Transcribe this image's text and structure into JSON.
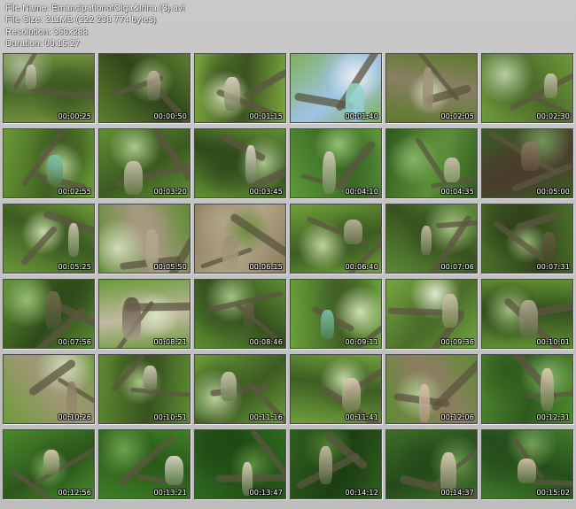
{
  "info": {
    "file_name": "File Name: EmancipationofOlga&Irina (3).avi",
    "file_size": "File Size: 211MB (222 238 774 bytes)",
    "resolution": "Resolution: 360x288",
    "duration": "Duration: 00:15:27"
  },
  "thumbnails": [
    {
      "time": "00:00:25",
      "palette": [
        "#6f8f3a",
        "#3f5a22",
        "#a7b892"
      ],
      "figure": "#d9cfc2"
    },
    {
      "time": "00:00:50",
      "palette": [
        "#5d7f2f",
        "#2f4519",
        "#9cb47a"
      ],
      "figure": "#c8b6a5"
    },
    {
      "time": "00:01:15",
      "palette": [
        "#7aa43e",
        "#3b5320",
        "#d6e2b8"
      ],
      "figure": "#e4d8c9"
    },
    {
      "time": "00:01:40",
      "palette": [
        "#7fb058",
        "#9fc4e8",
        "#e9edf0"
      ],
      "figure": "#8fd6c2"
    },
    {
      "time": "00:02:05",
      "palette": [
        "#5d7b2e",
        "#8a7f62",
        "#cfd7b9"
      ],
      "figure": "#a89a80"
    },
    {
      "time": "00:02:30",
      "palette": [
        "#6e9b3a",
        "#4c6b2a",
        "#b7cda0"
      ],
      "figure": "#d5c9bb"
    },
    {
      "time": "00:02:55",
      "palette": [
        "#6b9a35",
        "#3e5e22",
        "#b9d39a"
      ],
      "figure": "#7fc8b4"
    },
    {
      "time": "00:03:20",
      "palette": [
        "#5f8e33",
        "#3b5a20",
        "#aac98a"
      ],
      "figure": "#d8c9b7"
    },
    {
      "time": "00:03:45",
      "palette": [
        "#638f35",
        "#2f4a1b",
        "#a9c48b"
      ],
      "figure": "#e8e0d4"
    },
    {
      "time": "00:04:10",
      "palette": [
        "#5f9a3a",
        "#3a6a25",
        "#94c070"
      ],
      "figure": "#e0d2c4"
    },
    {
      "time": "00:04:35",
      "palette": [
        "#2f5a1f",
        "#5c8f3a",
        "#86b466"
      ],
      "figure": "#d8c4bb"
    },
    {
      "time": "00:05:00",
      "palette": [
        "#3a5e25",
        "#4a3c2c",
        "#72955a"
      ],
      "figure": "#8d7a60"
    },
    {
      "time": "00:05:25",
      "palette": [
        "#6a9838",
        "#3c5b22",
        "#c9dba8"
      ],
      "figure": "#d8cfc0"
    },
    {
      "time": "00:05:50",
      "palette": [
        "#5e8b32",
        "#a89a82",
        "#cfdcb9"
      ],
      "figure": "#b7aa95"
    },
    {
      "time": "00:06:15",
      "palette": [
        "#8a7c5e",
        "#b0a585",
        "#6a8a3a"
      ],
      "figure": "#9a8f72"
    },
    {
      "time": "00:06:40",
      "palette": [
        "#6fa23c",
        "#3d5c22",
        "#c0d49c"
      ],
      "figure": "#c9b8a8"
    },
    {
      "time": "00:07:06",
      "palette": [
        "#5c8b34",
        "#37521f",
        "#a7c283"
      ],
      "figure": "#d3c4b2"
    },
    {
      "time": "00:07:31",
      "palette": [
        "#4c6f2a",
        "#2f4319",
        "#9cb579"
      ],
      "figure": "#6a5a45"
    },
    {
      "time": "00:07:56",
      "palette": [
        "#5a8d30",
        "#2e4a1a",
        "#98bd72"
      ],
      "figure": "#7a6a52"
    },
    {
      "time": "00:08:21",
      "palette": [
        "#6a9a3a",
        "#c2b9a2",
        "#d8e3c2"
      ],
      "figure": "#5a4d3d"
    },
    {
      "time": "00:08:46",
      "palette": [
        "#5c8e32",
        "#354f1e",
        "#a4c382"
      ],
      "figure": "#6d5f4c"
    },
    {
      "time": "00:09:11",
      "palette": [
        "#6aa23a",
        "#405f24",
        "#cfe0b0"
      ],
      "figure": "#7fcbb5"
    },
    {
      "time": "00:09:36",
      "palette": [
        "#74a53e",
        "#4a6d2a",
        "#e1e8cf"
      ],
      "figure": "#d8c7b0"
    },
    {
      "time": "00:10:01",
      "palette": [
        "#5f8f32",
        "#344e1d",
        "#a2c07e"
      ],
      "figure": "#b9ad98"
    },
    {
      "time": "00:10:26",
      "palette": [
        "#6c9c3a",
        "#a29777",
        "#d0dcbc"
      ],
      "figure": "#8a7e64"
    },
    {
      "time": "00:10:51",
      "palette": [
        "#5d8a31",
        "#38521f",
        "#a8c288"
      ],
      "figure": "#e0d4c4"
    },
    {
      "time": "00:11:16",
      "palette": [
        "#6a9c38",
        "#3c5b22",
        "#b7cf98"
      ],
      "figure": "#d7cdbd"
    },
    {
      "time": "00:11:41",
      "palette": [
        "#6f9f3b",
        "#3e5e23",
        "#c3d7a2"
      ],
      "figure": "#e2c9b6"
    },
    {
      "time": "00:12:06",
      "palette": [
        "#5e8c33",
        "#8c7e60",
        "#b0c891"
      ],
      "figure": "#dcc1ad"
    },
    {
      "time": "00:12:31",
      "palette": [
        "#4f8a2e",
        "#2f5a1d",
        "#88b66a"
      ],
      "figure": "#e6cdb8"
    },
    {
      "time": "00:12:56",
      "palette": [
        "#4a8a2c",
        "#2c571b",
        "#7fb25f"
      ],
      "figure": "#e8d0bd"
    },
    {
      "time": "00:13:21",
      "palette": [
        "#3f7e26",
        "#2a5a19",
        "#6ea44f"
      ],
      "figure": "#efe3d4"
    },
    {
      "time": "00:13:47",
      "palette": [
        "#2f6a1f",
        "#1f4a14",
        "#5a8e3e"
      ],
      "figure": "#e7d6c6"
    },
    {
      "time": "00:14:12",
      "palette": [
        "#2f5e1e",
        "#1c3f12",
        "#4f7d35"
      ],
      "figure": "#d6c1ae"
    },
    {
      "time": "00:14:37",
      "palette": [
        "#3c6e26",
        "#25491a",
        "#6a9a4c"
      ],
      "figure": "#e9d3c2"
    },
    {
      "time": "00:15:02",
      "palette": [
        "#3f7a2a",
        "#264d1b",
        "#739f56"
      ],
      "figure": "#e4c9b5"
    }
  ]
}
